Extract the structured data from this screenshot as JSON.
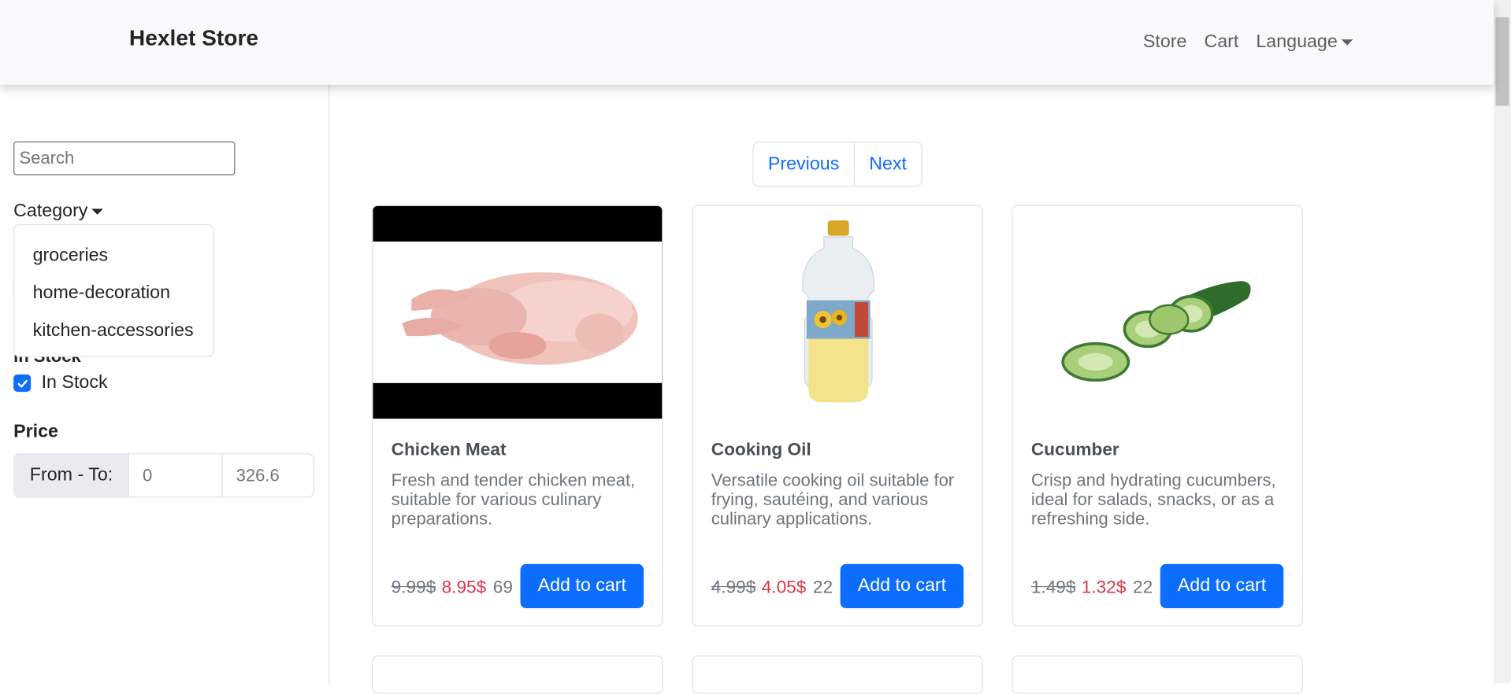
{
  "navbar": {
    "brand": "Hexlet Store",
    "links": [
      "Store",
      "Cart",
      "Language"
    ]
  },
  "sidebar": {
    "search_placeholder": "Search",
    "category_label": "Category",
    "categories": [
      "groceries",
      "home-decoration",
      "kitchen-accessories"
    ],
    "instock_heading": "In Stock",
    "instock_checkbox_label": "In Stock",
    "instock_checked": true,
    "price_title": "Price",
    "price_label": "From - To:",
    "price_from": "0",
    "price_to": "326.6"
  },
  "pagination": {
    "previous": "Previous",
    "next": "Next"
  },
  "products": [
    {
      "title": "Chicken Meat",
      "description": "Fresh and tender chicken meat, suitable for various culinary preparations.",
      "old_price": "9.99$",
      "new_price": "8.95$",
      "stock": "69",
      "button": "Add to cart"
    },
    {
      "title": "Cooking Oil",
      "description": "Versatile cooking oil suitable for frying, sautéing, and various culinary applications.",
      "old_price": "4.99$",
      "new_price": "4.05$",
      "stock": "22",
      "button": "Add to cart"
    },
    {
      "title": "Cucumber",
      "description": "Crisp and hydrating cucumbers, ideal for salads, snacks, or as a refreshing side.",
      "old_price": "1.49$",
      "new_price": "1.32$",
      "stock": "22",
      "button": "Add to cart"
    }
  ],
  "colors": {
    "primary": "#0d6efd",
    "sale": "#dc3545",
    "muted": "#6c757d",
    "navbar_bg": "#f8f9fa"
  }
}
